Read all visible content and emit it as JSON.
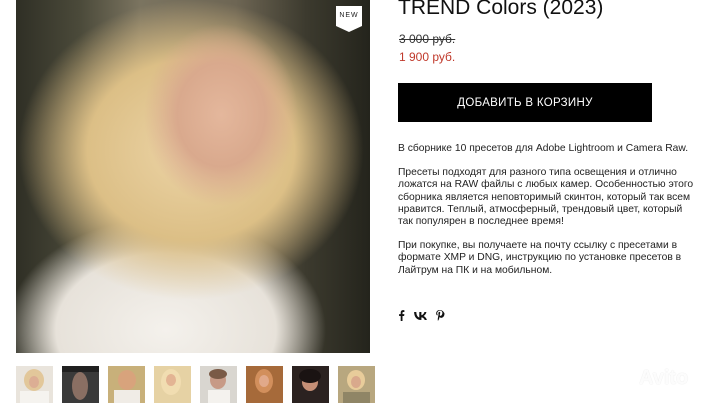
{
  "product": {
    "badge": "NEW",
    "title": "TREND Colors (2023)",
    "old_price": "3 000 руб.",
    "new_price": "1 900 руб.",
    "add_to_cart_label": "ДОБАВИТЬ В КОРЗИНУ",
    "description": [
      "В сборнике 10 пресетов для Adobe Lightroom и Camera Raw.",
      "Пресеты подходят для разного типа освещения и отлично ложатся на RAW файлы с любых камер. Особенностью этого сборника является неповторимый скинтон, который так всем нравится. Теплый, атмосферный, трендовый цвет, который так популярен в последнее время!",
      "При покупке, вы получаете на почту ссылку с пресетами в формате XMP и DNG, инструкцию по установке пресетов в Лайтрум на ПК и на мобильном."
    ]
  },
  "share": {
    "facebook": "f",
    "vk": "vk",
    "pinterest": "P"
  },
  "thumbnails": [
    "thumb-1",
    "thumb-2",
    "thumb-3",
    "thumb-4",
    "thumb-5",
    "thumb-6",
    "thumb-7",
    "thumb-8"
  ],
  "watermark": "Avito",
  "colors": {
    "accent": "#000000",
    "sale_price": "#c0392b"
  }
}
